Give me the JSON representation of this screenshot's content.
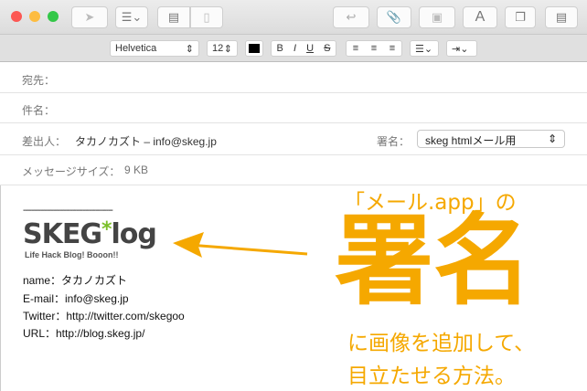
{
  "toolbar": {
    "icons": [
      "send-icon",
      "list-icon",
      "header-icon",
      "stationery-icon",
      "reply-icon",
      "attach-icon",
      "photo-icon",
      "font-icon",
      "window-icon",
      "format-icon"
    ],
    "font_button": "A"
  },
  "format_bar": {
    "font": "Helvetica",
    "size": "12",
    "bold": "B",
    "italic": "I",
    "underline": "U",
    "strike": "S"
  },
  "header": {
    "to_label": "宛先：",
    "subject_label": "件名：",
    "from_label": "差出人：",
    "from_value": "タカノカズト – info@skeg.jp",
    "signature_label": "署名：",
    "signature_value": "skeg htmlメール用",
    "size_label": "メッセージサイズ：",
    "size_value": "9 KB"
  },
  "body": {
    "separator": "------------------------------------------",
    "logo_text": "SKEG*log",
    "logo_tagline": "Life Hack Blog! Booon!!",
    "lines": [
      "name：タカノカズト",
      "E-mail：info@skeg.jp",
      "Twitter：http://twitter.com/skegoo",
      "URL：http://blog.skeg.jp/"
    ]
  },
  "overlay": {
    "line1": "「メール.app」の",
    "big": "署名",
    "line2": "に画像を追加して、",
    "line3": "目立たせる方法。",
    "color": "#f5a800"
  }
}
